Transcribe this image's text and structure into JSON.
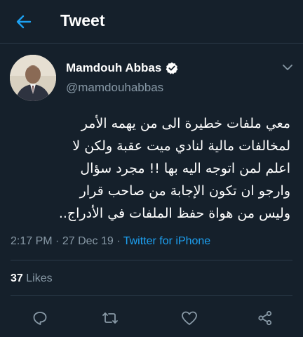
{
  "header": {
    "title": "Tweet",
    "back_icon": "arrow-left-icon"
  },
  "colors": {
    "background": "#15202b",
    "accent": "#1da1f2",
    "secondary_text": "#8899a6"
  },
  "author": {
    "name": "Mamdouh Abbas",
    "handle": "@mamdouhabbas",
    "verified": true
  },
  "tweet": {
    "text": "معي ملفات خطيرة الى من يهمه الأمر\nلمخالفات مالية لنادي ميت عقبة ولكن لا\nاعلم لمن اتوجه اليه بها !! مجرد سؤال\nوارجو ان تكون الإجابة من صاحب قرار\nوليس من هواة حفظ الملفات  في الأدراج..",
    "time": "2:17 PM",
    "separator": "·",
    "date": "27 Dec 19",
    "source": "Twitter for iPhone"
  },
  "stats": {
    "likes_count": "37",
    "likes_label": "Likes"
  },
  "actions": {
    "reply_icon": "reply-icon",
    "retweet_icon": "retweet-icon",
    "like_icon": "heart-icon",
    "share_icon": "share-icon"
  }
}
